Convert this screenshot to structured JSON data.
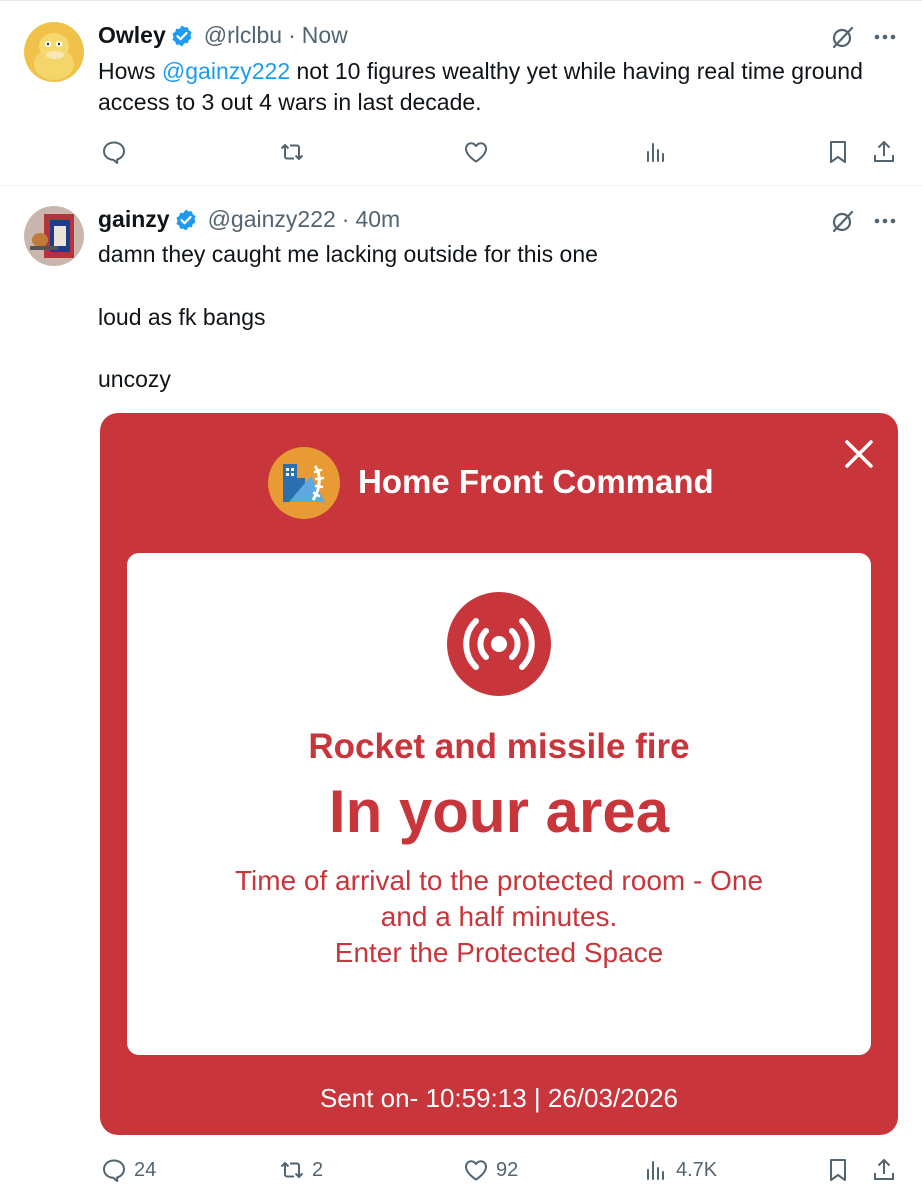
{
  "tweets": [
    {
      "name": "Owley",
      "handle": "@rlclbu",
      "separator": "·",
      "time": "Now",
      "text_before": "Hows ",
      "mention": "@gainzy222",
      "text_after": " not 10 figures wealthy yet while having real time ground access to 3 out 4 wars in last decade."
    },
    {
      "name": "gainzy",
      "handle": "@gainzy222",
      "separator": "·",
      "time": "40m",
      "lines": [
        "damn they caught me lacking outside for this one",
        "loud as fk bangs",
        "uncozy"
      ],
      "stats": {
        "replies": "24",
        "reposts": "2",
        "likes": "92",
        "views": "4.7K"
      }
    }
  ],
  "alert": {
    "title": "Home Front Command",
    "type": "Rocket and missile fire",
    "area": "In your area",
    "message_line1": "Time of arrival to the protected room - One",
    "message_line2": "and a half minutes.",
    "message_line3": "Enter the Protected Space",
    "sent": "Sent on- 10:59:13 | 26/03/2026"
  },
  "colors": {
    "accent": "#1d9bf0",
    "alert_red": "#c8353b",
    "muted": "#536471",
    "text": "#0f1419"
  },
  "icons": [
    "verified-badge-icon",
    "grok-icon",
    "more-icon",
    "reply-icon",
    "repost-icon",
    "like-icon",
    "views-icon",
    "bookmark-icon",
    "share-icon",
    "close-icon",
    "siren-icon"
  ]
}
